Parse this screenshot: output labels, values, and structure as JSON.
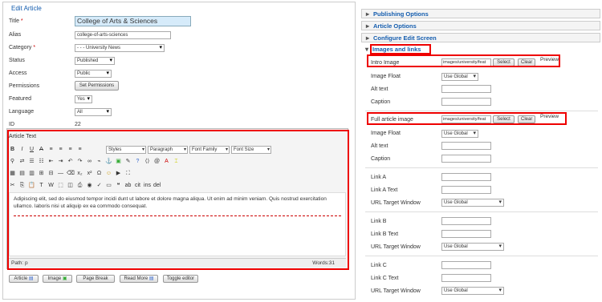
{
  "fieldset": {
    "legend": "Edit Article"
  },
  "fields": {
    "title_label": "Title",
    "title_value": "College of Arts & Sciences",
    "alias_label": "Alias",
    "alias_value": "college-of-arts-sciences",
    "category_label": "Category",
    "category_value": "- - - University News",
    "status_label": "Status",
    "status_value": "Published",
    "access_label": "Access",
    "access_value": "Public",
    "permissions_label": "Permissions",
    "permissions_button": "Set Permissions",
    "featured_label": "Featured",
    "featured_value": "Yes",
    "language_label": "Language",
    "language_value": "All",
    "id_label": "ID",
    "id_value": "22",
    "article_text_label": "Article Text"
  },
  "editor": {
    "styles": "Styles",
    "paragraph": "Paragraph",
    "font_family": "Font Family",
    "font_size": "Font Size",
    "content": "Adipiscing elit, sed do eiusmod tempor incidi dunt ut labore et dolore magna aliqua. Ut enim ad minim veniam. Quis nostrud exercitation ullamco. laboris nisi ut aliquip ex ea commodo consequat.",
    "path": "Path: p",
    "words": "Words:31"
  },
  "bottom_buttons": [
    "Article",
    "Image",
    "Page Break",
    "Read More",
    "Toggle editor"
  ],
  "right": {
    "panels": [
      "Publishing Options",
      "Article Options",
      "Configure Edit Screen",
      "Images and links"
    ],
    "intro_image_label": "Intro Image",
    "intro_image_value": "images/university/feat",
    "select": "Select",
    "clear": "Clear",
    "preview": "Preview",
    "image_float_label": "Image Float",
    "use_global": "Use Global",
    "alt_text_label": "Alt text",
    "caption_label": "Caption",
    "full_image_label": "Full article image",
    "full_image_value": "images/university/feat",
    "link_a": "Link A",
    "link_a_text": "Link A Text",
    "link_b": "Link B",
    "link_b_text": "Link B Text",
    "link_c": "Link C",
    "link_c_text": "Link C Text",
    "url_target": "URL Target Window"
  },
  "colors": {
    "accent": "#135cae",
    "highlight": "#e00000",
    "title_bg": "#d6ebfa"
  }
}
